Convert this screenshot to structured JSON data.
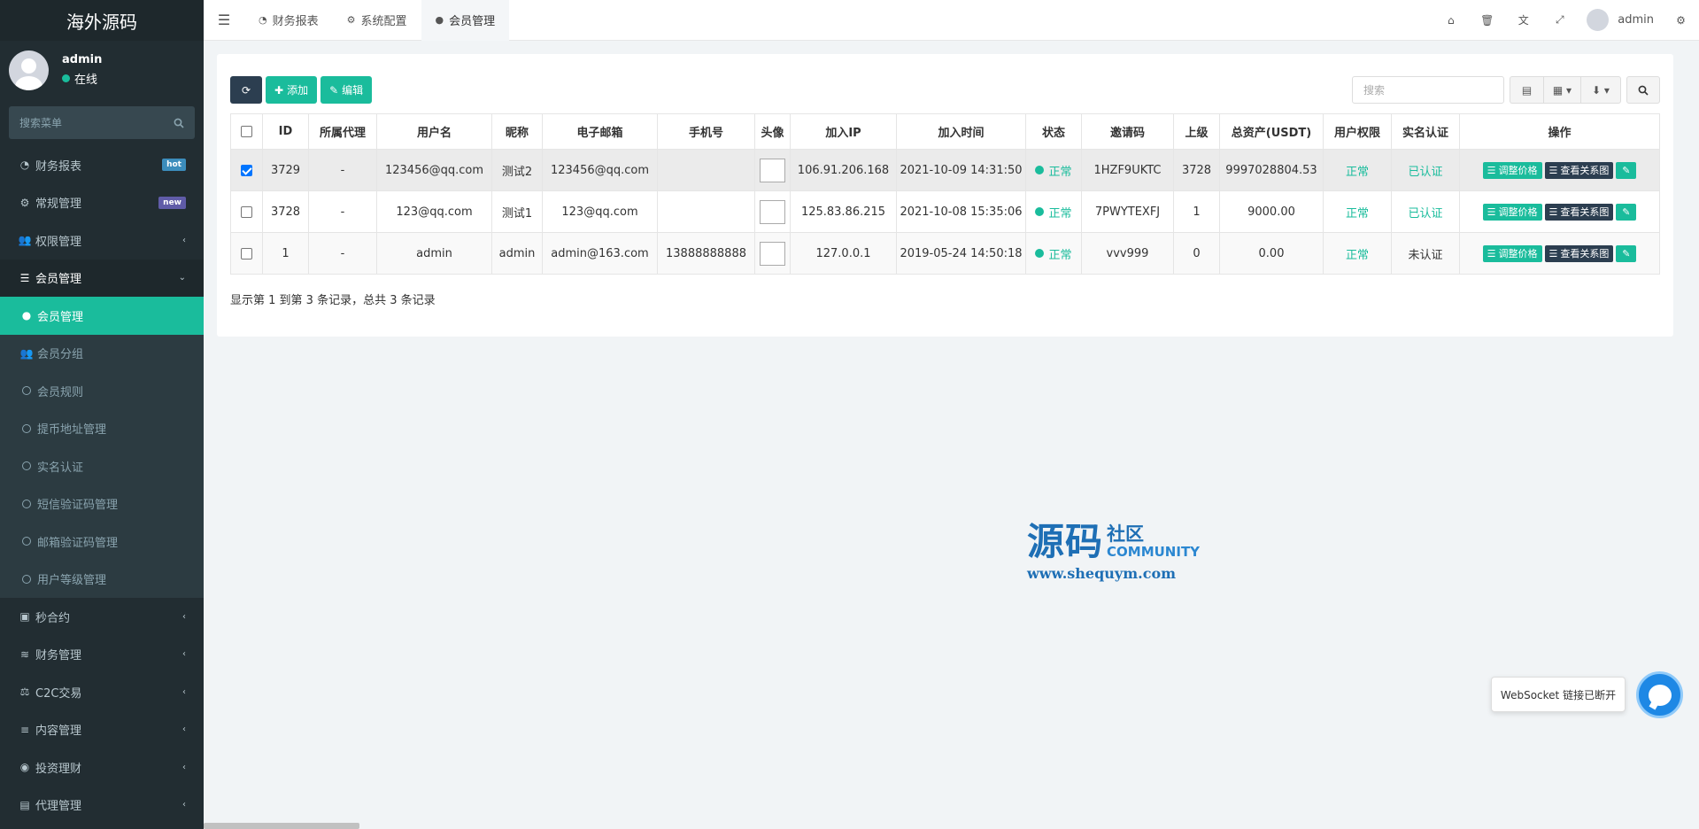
{
  "app": {
    "logo": "海外源码"
  },
  "user_panel": {
    "name": "admin",
    "status": "在线"
  },
  "sidebar_search": {
    "placeholder": "搜索菜单"
  },
  "menu": {
    "finance_report": {
      "label": "财务报表",
      "badge": "hot"
    },
    "general": {
      "label": "常规管理",
      "badge": "new"
    },
    "permission": {
      "label": "权限管理"
    },
    "member_mgmt": {
      "label": "会员管理"
    },
    "sub": {
      "member": "会员管理",
      "group": "会员分组",
      "rules": "会员规则",
      "withdraw_addr": "提币地址管理",
      "realname": "实名认证",
      "sms": "短信验证码管理",
      "email": "邮箱验证码管理",
      "level": "用户等级管理"
    },
    "seconds_contract": {
      "label": "秒合约"
    },
    "finance_mgmt": {
      "label": "财务管理"
    },
    "c2c": {
      "label": "C2C交易"
    },
    "content": {
      "label": "内容管理"
    },
    "invest": {
      "label": "投资理财"
    },
    "agent": {
      "label": "代理管理"
    }
  },
  "header": {
    "tabs": [
      "财务报表",
      "系统配置",
      "会员管理"
    ],
    "user": "admin"
  },
  "toolbar": {
    "add": "添加",
    "edit": "编辑",
    "search_placeholder": "搜索"
  },
  "table": {
    "columns": [
      "ID",
      "所属代理",
      "用户名",
      "昵称",
      "电子邮箱",
      "手机号",
      "头像",
      "加入IP",
      "加入时间",
      "状态",
      "邀请码",
      "上级",
      "总资产(USDT)",
      "用户权限",
      "实名认证",
      "操作"
    ],
    "rows": [
      {
        "id": "3729",
        "agent": "-",
        "username": "123456@qq.com",
        "nickname": "测试2",
        "email": "123456@qq.com",
        "phone": "",
        "ip": "106.91.206.168",
        "time": "2021-10-09 14:31:50",
        "status": "正常",
        "invite": "1HZF9UKTC",
        "parent": "3728",
        "assets": "9997028804.53",
        "perm": "正常",
        "realname": "已认证"
      },
      {
        "id": "3728",
        "agent": "-",
        "username": "123@qq.com",
        "nickname": "测试1",
        "email": "123@qq.com",
        "phone": "",
        "ip": "125.83.86.215",
        "time": "2021-10-08 15:35:06",
        "status": "正常",
        "invite": "7PWYTEXFJ",
        "parent": "1",
        "assets": "9000.00",
        "perm": "正常",
        "realname": "已认证"
      },
      {
        "id": "1",
        "agent": "-",
        "username": "admin",
        "nickname": "admin",
        "email": "admin@163.com",
        "phone": "13888888888",
        "ip": "127.0.0.1",
        "time": "2019-05-24 14:50:18",
        "status": "正常",
        "invite": "vvv999",
        "parent": "0",
        "assets": "0.00",
        "perm": "正常",
        "realname": "未认证"
      }
    ],
    "ops": {
      "adjust_price": "调整价格",
      "view_relation": "查看关系图"
    }
  },
  "pagination": "显示第 1 到第 3 条记录，总共 3 条记录",
  "watermark": {
    "big": "源码",
    "small": "社区",
    "community": "COMMUNITY",
    "url": "www.shequym.com"
  },
  "websocket": {
    "tip": "WebSocket 链接已断开"
  },
  "colors": {
    "accent": "#1abc9c",
    "sidebar": "#222d32",
    "dark_button": "#2c3e50"
  }
}
